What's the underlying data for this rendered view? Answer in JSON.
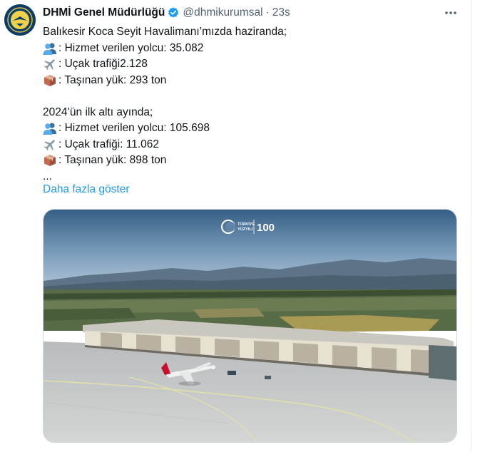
{
  "tweet": {
    "display_name": "DHMİ Genel Müdürlüğü",
    "handle": "@dhmikurumsal",
    "separator": "·",
    "time": "23s",
    "lines": {
      "l1": "Balıkesir Koca Seyit Havalimanı’mızda haziranda;",
      "l2": ": Hizmet verilen yolcu: 35.082",
      "l3": ": Uçak trafiği2.128",
      "l4": ": Taşınan yük: 293 ton",
      "l5": "2024’ün ilk altı ayında;",
      "l6": ": Hizmet verilen yolcu: 105.698",
      "l7": ": Uçak trafiği: 11.062",
      "l8": ": Taşınan yük: 898 ton",
      "l9": "..."
    },
    "show_more": "Daha fazla göster",
    "icons": {
      "passenger": "busts-in-silhouette-icon",
      "plane": "airplane-icon",
      "cargo": "package-icon",
      "verified": "verified-badge-icon",
      "more": "more-options-icon"
    },
    "media_logo": {
      "left": "TÜRKİYE YÜZYILI",
      "right": "100"
    }
  },
  "colors": {
    "link": "#1d9bf0",
    "secondary_text": "#536471",
    "verified": "#1d9bf0"
  }
}
